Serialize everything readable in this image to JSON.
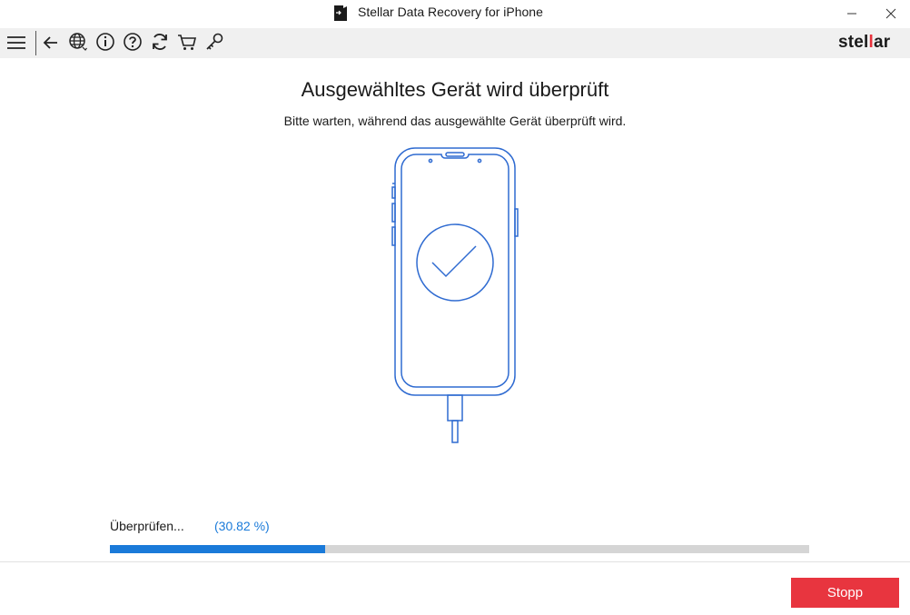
{
  "window": {
    "title": "Stellar Data Recovery for iPhone",
    "minimize_icon": "minimize-icon",
    "close_icon": "close-icon"
  },
  "toolbar": {
    "icons": [
      "menu-icon",
      "back-arrow-icon",
      "globe-icon",
      "info-icon",
      "help-icon",
      "refresh-icon",
      "cart-icon",
      "key-icon"
    ],
    "brand_prefix": "stel",
    "brand_highlight": "l",
    "brand_suffix": "ar"
  },
  "main": {
    "heading": "Ausgewähltes Gerät wird überprüft",
    "subheading": "Bitte warten, während das ausgewählte Gerät überprüft wird.",
    "illustration": "phone-check-icon"
  },
  "progress": {
    "label": "Überprüfen...",
    "percent_text": "(30.82 %)",
    "value": 0.3082
  },
  "footer": {
    "stop_label": "Stopp"
  },
  "colors": {
    "accent_blue": "#1a7ad9",
    "progress_track": "#d5d5d5",
    "stop_red": "#e8353f",
    "brand_red": "#e8323c",
    "line_art": "#2f6bd1"
  }
}
